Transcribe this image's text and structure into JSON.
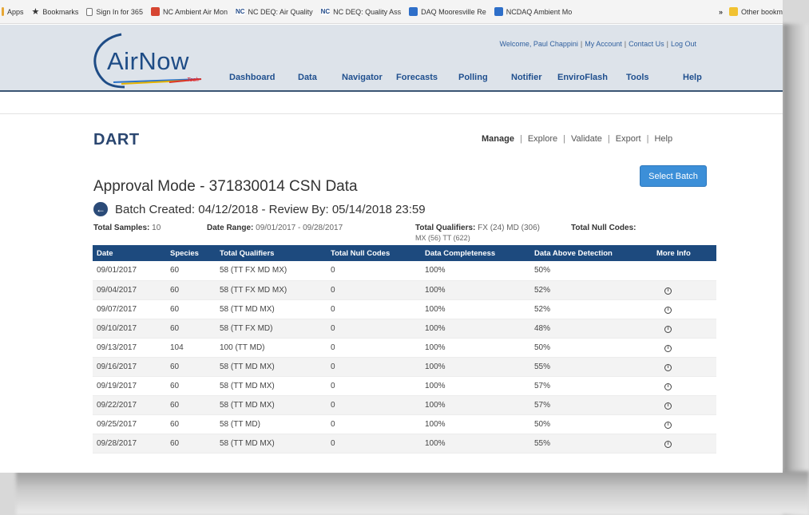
{
  "bookmarks": [
    {
      "icon": "apps-icon",
      "label": "Apps"
    },
    {
      "icon": "star-icon",
      "label": "Bookmarks"
    },
    {
      "icon": "page-icon",
      "label": "Sign In for 365"
    },
    {
      "icon": "map-pin-icon",
      "label": "NC Ambient Air Mon"
    },
    {
      "icon": "nc-logo-icon",
      "label": "NC DEQ: Air Quality"
    },
    {
      "icon": "nc-logo-icon",
      "label": "NC DEQ: Quality Ass"
    },
    {
      "icon": "sharepoint-icon",
      "label": "DAQ Mooresville Re"
    },
    {
      "icon": "sharepoint-icon",
      "label": "NCDAQ Ambient Mo"
    }
  ],
  "bookmarks_overflow": "»",
  "bookmarks_other": "Other bookm",
  "header": {
    "logo_text": "AirNow",
    "logo_sub": "Tech",
    "welcome": "Welcome, Paul Chappini",
    "my_account": "My Account",
    "contact_us": "Contact Us",
    "log_out": "Log Out",
    "nav": [
      "Dashboard",
      "Data",
      "Navigator",
      "Forecasts",
      "Polling",
      "Notifier",
      "EnviroFlash",
      "Tools",
      "Help"
    ]
  },
  "page": {
    "app_title": "DART",
    "subnav": [
      "Manage",
      "Explore",
      "Validate",
      "Export",
      "Help"
    ],
    "select_batch": "Select Batch",
    "title": "Approval Mode - 371830014 CSN Data",
    "batch_line": "Batch Created: 04/12/2018 - Review By: 05/14/2018 23:59",
    "summary": {
      "total_samples_label": "Total Samples:",
      "total_samples_value": "10",
      "date_range_label": "Date Range:",
      "date_range_value": "09/01/2017 - 09/28/2017",
      "total_qualifiers_label": "Total Qualifiers:",
      "total_qualifiers_value_1": "FX (24) MD (306)",
      "total_qualifiers_value_2": "MX (56) TT (622)",
      "total_null_label": "Total Null Codes:"
    }
  },
  "table": {
    "columns": [
      "Date",
      "Species",
      "Total Qualifiers",
      "Total Null Codes",
      "Data Completeness",
      "Data Above Detection",
      "More Info"
    ],
    "rows": [
      {
        "date": "09/01/2017",
        "species": "60",
        "qualifiers": "58 (TT FX MD MX)",
        "null": "0",
        "completeness": "100%",
        "above": "50%",
        "info": false
      },
      {
        "date": "09/04/2017",
        "species": "60",
        "qualifiers": "58 (TT FX MD MX)",
        "null": "0",
        "completeness": "100%",
        "above": "52%",
        "info": true
      },
      {
        "date": "09/07/2017",
        "species": "60",
        "qualifiers": "58 (TT MD MX)",
        "null": "0",
        "completeness": "100%",
        "above": "52%",
        "info": true
      },
      {
        "date": "09/10/2017",
        "species": "60",
        "qualifiers": "58 (TT FX MD)",
        "null": "0",
        "completeness": "100%",
        "above": "48%",
        "info": true
      },
      {
        "date": "09/13/2017",
        "species": "104",
        "qualifiers": "100 (TT MD)",
        "null": "0",
        "completeness": "100%",
        "above": "50%",
        "info": true
      },
      {
        "date": "09/16/2017",
        "species": "60",
        "qualifiers": "58 (TT MD MX)",
        "null": "0",
        "completeness": "100%",
        "above": "55%",
        "info": true
      },
      {
        "date": "09/19/2017",
        "species": "60",
        "qualifiers": "58 (TT MD MX)",
        "null": "0",
        "completeness": "100%",
        "above": "57%",
        "info": true
      },
      {
        "date": "09/22/2017",
        "species": "60",
        "qualifiers": "58 (TT MD MX)",
        "null": "0",
        "completeness": "100%",
        "above": "57%",
        "info": true
      },
      {
        "date": "09/25/2017",
        "species": "60",
        "qualifiers": "58 (TT MD)",
        "null": "0",
        "completeness": "100%",
        "above": "50%",
        "info": true
      },
      {
        "date": "09/28/2017",
        "species": "60",
        "qualifiers": "58 (TT MD MX)",
        "null": "0",
        "completeness": "100%",
        "above": "55%",
        "info": true
      }
    ]
  },
  "colors": {
    "nav_text": "#1f4f8e",
    "header_bg": "#dde3ea",
    "table_header": "#1d4a7e",
    "button": "#3c8fd8"
  }
}
